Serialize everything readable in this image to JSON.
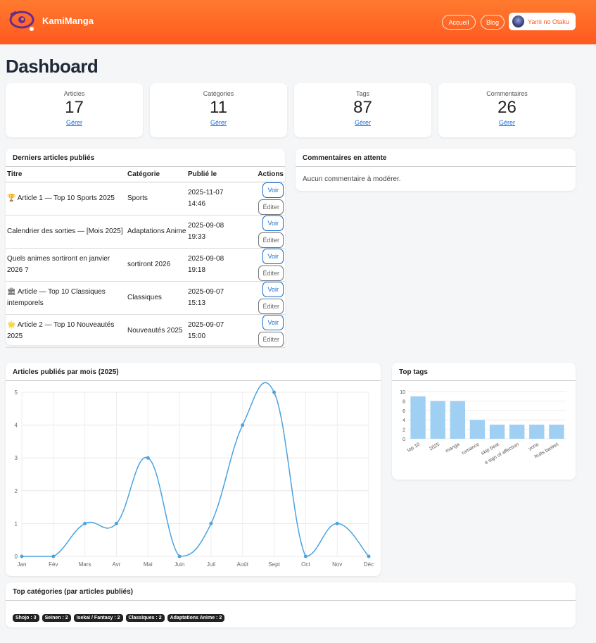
{
  "header": {
    "brand": "KamiManga",
    "nav": [
      {
        "label": "Accueil"
      },
      {
        "label": "Blog"
      }
    ],
    "user": "Yami no Otaku"
  },
  "page_title": "Dashboard",
  "stats": [
    {
      "label": "Articles",
      "value": "17",
      "link": "Gérer"
    },
    {
      "label": "Catégories",
      "value": "11",
      "link": "Gérer"
    },
    {
      "label": "Tags",
      "value": "87",
      "link": "Gérer"
    },
    {
      "label": "Commentaires",
      "value": "26",
      "link": "Gérer"
    }
  ],
  "latest": {
    "title": "Derniers articles publiés",
    "columns": [
      "Titre",
      "Catégorie",
      "Publié le",
      "Actions"
    ],
    "view_label": "Voir",
    "edit_label": "Éditer",
    "rows": [
      {
        "icon": "🏆",
        "title": "Article 1 — Top 10 Sports 2025",
        "category": "Sports",
        "date": "2025-11-07",
        "time": "14:46"
      },
      {
        "icon": "",
        "title": "Calendrier des sorties — [Mois 2025]",
        "category": "Adaptations Anime",
        "date": "2025-09-08",
        "time": "19:33"
      },
      {
        "icon": "",
        "title": "Quels animes sortiront en janvier 2026 ?",
        "category": "sortiront 2026",
        "date": "2025-09-08",
        "time": "19:18"
      },
      {
        "icon": "🏛",
        "title": "Article — Top 10 Classiques intemporels",
        "category": "Classiques",
        "date": "2025-09-07",
        "time": "15:13"
      },
      {
        "icon": "🌟",
        "title": "Article 2 — Top 10 Nouveautés 2025",
        "category": "Nouveautés 2025",
        "date": "2025-09-07",
        "time": "15:00"
      }
    ]
  },
  "pending": {
    "title": "Commentaires en attente",
    "empty": "Aucun commentaire à modérer."
  },
  "chart_data": [
    {
      "type": "line",
      "title": "Articles publiés par mois (2025)",
      "x": [
        "Jan",
        "Fév",
        "Mars",
        "Avr",
        "Mai",
        "Juin",
        "Juil",
        "Août",
        "Sept",
        "Oct",
        "Nov",
        "Déc"
      ],
      "series": [
        {
          "values": [
            0,
            0,
            1,
            1,
            3,
            0,
            1,
            4,
            5,
            0,
            1,
            0
          ]
        }
      ],
      "ylim": [
        0,
        5
      ],
      "yticks": [
        0,
        1,
        2,
        3,
        4,
        5
      ],
      "grid": true,
      "color": "#4aa3df"
    },
    {
      "type": "bar",
      "title": "Top tags",
      "categories": [
        "top 10",
        "2025",
        "manga",
        "romance",
        "skip beat",
        "a sign of affection",
        "yona",
        "fruits basket"
      ],
      "values": [
        9,
        8,
        8,
        4,
        3,
        3,
        3,
        3
      ],
      "ylim": [
        0,
        10
      ],
      "yticks": [
        0,
        2,
        4,
        6,
        8,
        10
      ],
      "grid": true,
      "color": "#9fd0f3"
    }
  ],
  "categories": {
    "title": "Top catégories (par articles publiés)",
    "badges": [
      "Shojo : 3",
      "Seinen : 2",
      "Isekai / Fantasy : 2",
      "Classiques : 2",
      "Adaptations Anime : 2"
    ]
  }
}
